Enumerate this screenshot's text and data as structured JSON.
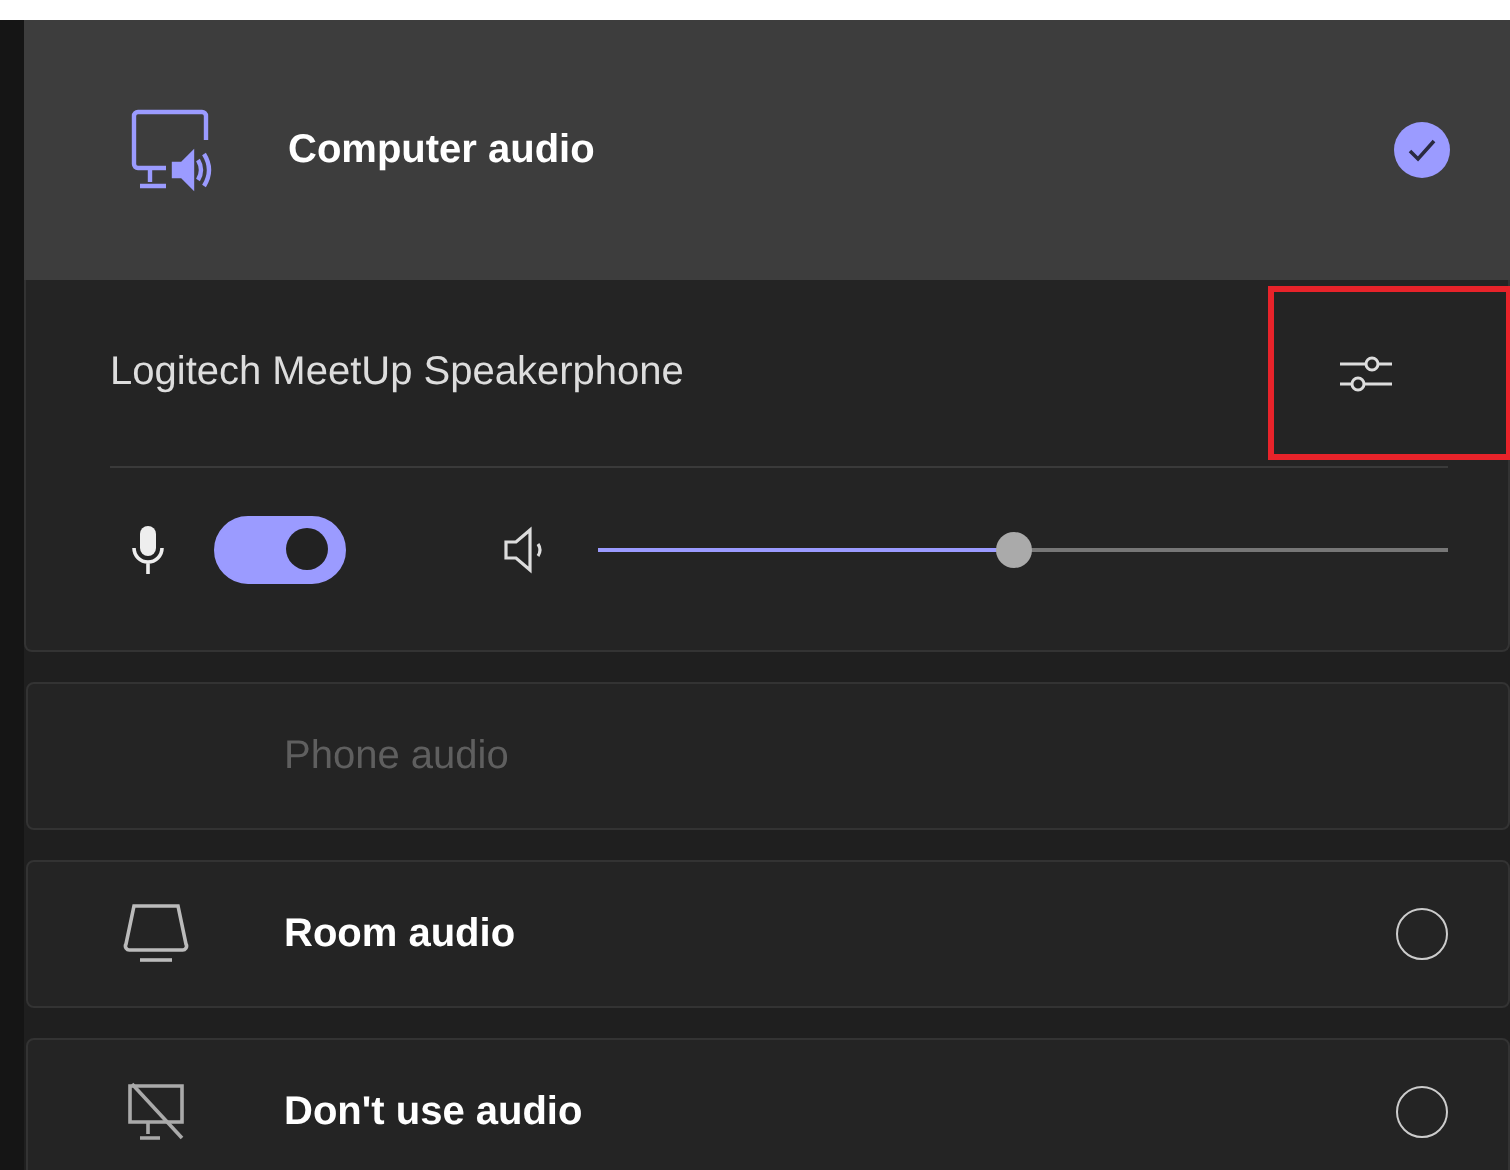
{
  "options": [
    {
      "kind": "computer",
      "label": "Computer audio",
      "selected": true,
      "disabled": false
    },
    {
      "kind": "phone",
      "label": "Phone audio",
      "selected": false,
      "disabled": true
    },
    {
      "kind": "room",
      "label": "Room audio",
      "selected": false,
      "disabled": false
    },
    {
      "kind": "none",
      "label": "Don't use audio",
      "selected": false,
      "disabled": false
    }
  ],
  "device": {
    "name": "Logitech MeetUp Speakerphone",
    "settings_highlighted": true,
    "mic_on": true,
    "level": 0.49
  }
}
